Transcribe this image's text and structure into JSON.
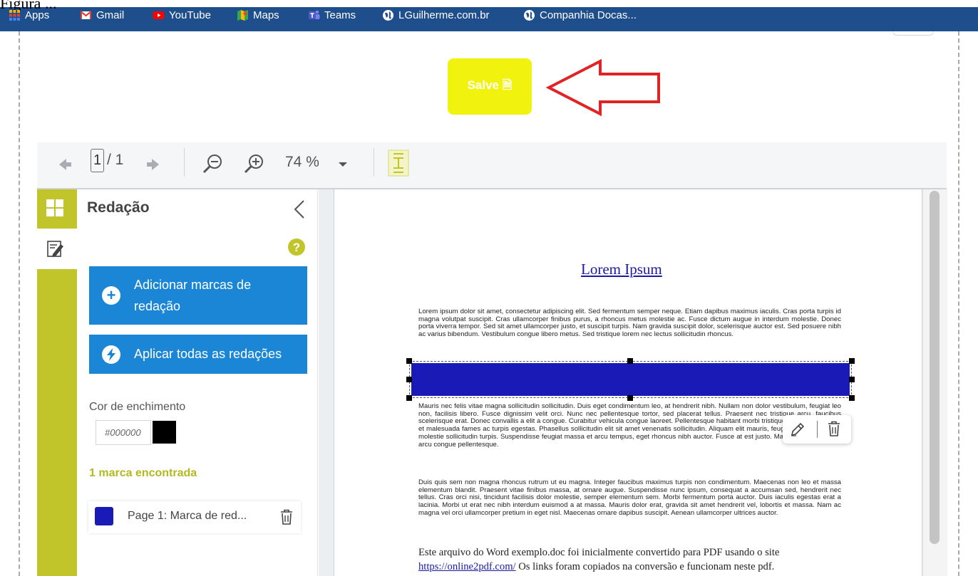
{
  "screenshot_caption": "Figura ...",
  "bookmarks": [
    {
      "label": "Apps",
      "icon": "apps-grid-icon"
    },
    {
      "label": "Gmail",
      "icon": "gmail-icon"
    },
    {
      "label": "YouTube",
      "icon": "youtube-icon"
    },
    {
      "label": "Maps",
      "icon": "maps-icon"
    },
    {
      "label": "Teams",
      "icon": "teams-icon"
    },
    {
      "label": "LGuilherme.com.br",
      "icon": "globe-icon"
    },
    {
      "label": "Companhia Docas...",
      "icon": "globe-icon"
    }
  ],
  "save_button": {
    "label": "Salve 🗎"
  },
  "toolbar": {
    "page_current": "1",
    "page_total": "/ 1",
    "zoom": "74 %",
    "icons": [
      "prev-page-icon",
      "next-page-icon",
      "zoom-out-icon",
      "zoom-in-icon",
      "zoom-dropdown-icon",
      "fit-page-icon"
    ]
  },
  "sidebar": {
    "title": "Redação",
    "add_marks_label": "Adicionar marcas de redação",
    "apply_all_label": "Aplicar todas as redações",
    "fill_color_label": "Cor de enchimento",
    "fill_color_value": "#000000",
    "found_label": "1 marca encontrada",
    "mark_item_label": "Page 1: Marca de red...",
    "gutter_grip": "II"
  },
  "document": {
    "title": "Lorem Ipsum",
    "para1": "Lorem ipsum dolor sit amet, consectetur adipiscing elit. Sed fermentum semper neque. Etiam dapibus maximus iaculis. Cras porta turpis id magna volutpat suscipit. Cras ullamcorper finibus purus, a rhoncus metus molestie ac. Fusce dictum augue in interdum molestie. Donec porta viverra tempor. Sed sit amet ullamcorper justo, et suscipit turpis. Nam gravida suscipit dolor, scelerisque auctor est. Sed posuere nibh ac varius bibendum. Vestibulum congue libero metus. Sed tristique lorem nec lectus sollicitudin rhoncus.",
    "para2": "Mauris nec felis vitae magna sollicitudin sollicitudin. Duis eget condimentum leo, at hendrerit nibh. Nullam non dolor vestibulum, feugiat leo non, facilisis libero. Fusce dignissim velit orci. Nunc nec pellentesque tortor, sed placerat tellus. Praesent nec tristique arcu, faucibus scelerisque erat. Donec convallis a elit a congue. Curabitur vehicula congue laoreet. Pellentesque habitant morbi tristique senectus et netus et malesuada fames ac turpis egestas. Phasellus sollicitudin elit sit amet venenatis sollicitudin. Aliquam elit mauris, feugiat sed augue sed, molestie sollicitudin turpis. Suspendisse feugiat massa et arcu tempus, eget rhoncus nibh auctor. Fusce at est justo. Mauris auctor ligula in arcu congue pellentesque.",
    "para3": "Duis quis sem non magna rhoncus rutrum ut eu magna. Integer faucibus maximus turpis non condimentum. Maecenas non leo et massa elementum blandit. Praesent vitae finibus massa, at ornare augue. Suspendisse nunc ipsum, consequat a accumsan sed, hendrerit nec tellus. Cras orci nisi, tincidunt facilisis dolor molestie, semper elementum sem. Morbi fermentum porta auctor. Duis iaculis egestas erat a lacinia. Morbi ut erat nec nibh interdum euismod a at massa. Mauris dolor erat, gravida sit amet hendrerit vel, lobortis et massa. Nam ac magna vel orci ullamcorper pretium in eget nisl. Maecenas ornare dapibus suscipit. Aenean ullamcorper ultrices auctor.",
    "footer_line1": "Este arquivo do Word exemplo.doc foi inicialmente convertido para PDF usando o site",
    "footer_link": "https://online2pdf.com/",
    "footer_line2_rest": " Os links foram copiados na conversão e funcionam neste pdf."
  },
  "colors": {
    "bookmarks_bar": "#1f4e8c",
    "save_button": "#f2f20f",
    "arrow": "#e02424",
    "rail": "#c1c52a",
    "panel_button": "#1b86d6",
    "redaction_fill": "#1a1ab6",
    "found_text": "#b4b820"
  }
}
